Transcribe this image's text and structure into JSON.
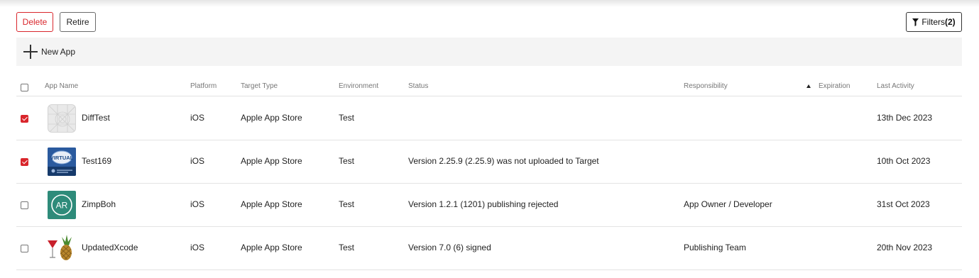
{
  "toolbar": {
    "delete_label": "Delete",
    "retire_label": "Retire",
    "filters_label": "Filters",
    "filters_count": "(2)"
  },
  "new_app": {
    "label": "New App"
  },
  "table": {
    "columns": {
      "app_name": "App Name",
      "platform": "Platform",
      "target_type": "Target Type",
      "environment": "Environment",
      "status": "Status",
      "responsibility": "Responsibility",
      "expiration": "Expiration",
      "last_activity": "Last Activity"
    },
    "sorted_column": "expiration",
    "sort_direction": "ascending",
    "rows": [
      {
        "checked": true,
        "icon": "placeholder-app-icon",
        "name": "DiffTest",
        "platform": "iOS",
        "target_type": "Apple App Store",
        "environment": "Test",
        "status": "",
        "responsibility": "",
        "expiration": "",
        "last_activity": "13th Dec 2023"
      },
      {
        "checked": true,
        "icon": "virtual-app-icon",
        "icon_text": "VIRTUAL",
        "name": "Test169",
        "platform": "iOS",
        "target_type": "Apple App Store",
        "environment": "Test",
        "status": "Version 2.25.9 (2.25.9) was not uploaded to Target",
        "responsibility": "",
        "expiration": "",
        "last_activity": "10th Oct 2023"
      },
      {
        "checked": false,
        "icon": "ar-app-icon",
        "icon_text": "AR",
        "name": "ZimpBoh",
        "platform": "iOS",
        "target_type": "Apple App Store",
        "environment": "Test",
        "status": "Version 1.2.1 (1201) publishing rejected",
        "responsibility": "App Owner / Developer",
        "expiration": "",
        "last_activity": "31st Oct 2023"
      },
      {
        "checked": false,
        "icon": "pineapple-cocktail-icon",
        "name": "UpdatedXcode",
        "platform": "iOS",
        "target_type": "Apple App Store",
        "environment": "Test",
        "status": "Version 7.0 (6) signed",
        "responsibility": "Publishing Team",
        "expiration": "",
        "last_activity": "20th Nov 2023"
      }
    ]
  },
  "colors": {
    "accent": "#d9262c",
    "header_text": "#777777",
    "bar_bg": "#f4f4f4",
    "ar_icon_bg": "#2e8b7a",
    "virtual_icon_bg": "#1f4b86"
  }
}
